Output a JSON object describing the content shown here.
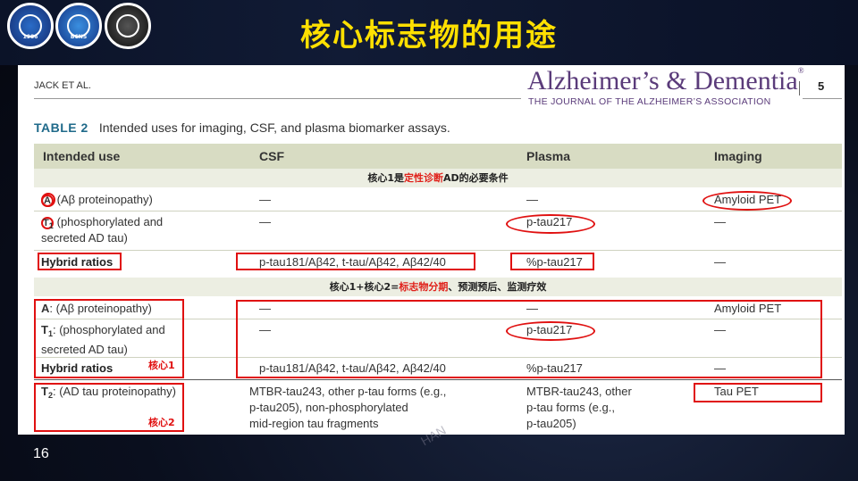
{
  "slide": {
    "title": "核心标志物的用途",
    "number": "16",
    "watermark": "HAN",
    "logos": [
      {
        "name": "association-logo-1",
        "year": "1986"
      },
      {
        "name": "bcns-logo",
        "text": "BCNS"
      },
      {
        "name": "brain-seal-logo"
      }
    ]
  },
  "document": {
    "running_head": "JACK ET AL.",
    "journal": "Alzheimer’s & Dementia",
    "journal_subtitle": "THE JOURNAL OF THE ALZHEIMER’S ASSOCIATION",
    "page_number": "5",
    "caption_label": "TABLE 2",
    "caption_text": "Intended uses for imaging, CSF, and plasma biomarker assays."
  },
  "table": {
    "headers": [
      "Intended use",
      "CSF",
      "Plasma",
      "Imaging"
    ],
    "band1": {
      "pre": "核心1是",
      "highlight": "定性诊断",
      "post": "AD的必要条件"
    },
    "band2": {
      "pre": "核心1+核心2=",
      "highlight": "标志物分期",
      "post": "、预测预后、监测疗效"
    },
    "rows": {
      "r1": {
        "use": "(Aβ proteinopathy)",
        "csf": "—",
        "plasma": "—",
        "imaging": "Amyloid PET"
      },
      "r2": {
        "use_a": "(phosphorylated and",
        "use_b": "secreted AD tau)",
        "csf": "—",
        "plasma": "p-tau217",
        "imaging": "—"
      },
      "r3": {
        "use": "Hybrid ratios",
        "csf": "p-tau181/Aβ42, t-tau/Aβ42, Aβ42/40",
        "plasma": "%p-tau217",
        "imaging": "—"
      },
      "r4": {
        "use": ": (Aβ proteinopathy)",
        "csf": "—",
        "plasma": "—",
        "imaging": "Amyloid PET"
      },
      "r5": {
        "use_a": ": (phosphorylated and",
        "use_b": "secreted AD tau)",
        "csf": "—",
        "plasma": "p-tau217",
        "imaging": "—"
      },
      "r6": {
        "use": "Hybrid ratios",
        "csf": "p-tau181/Aβ42, t-tau/Aβ42, Aβ42/40",
        "plasma": "%p-tau217",
        "imaging": "—"
      },
      "r7": {
        "use": ": (AD tau proteinopathy)",
        "csf_a": "MTBR-tau243, other p-tau forms (e.g.,",
        "csf_b": "p-tau205), non-phosphorylated",
        "csf_c": "mid-region tau fragments",
        "plasma_a": "MTBR-tau243, other",
        "plasma_b": "p-tau forms (e.g.,",
        "plasma_c": "p-tau205)",
        "imaging": "Tau PET"
      }
    },
    "labels": {
      "a": "A",
      "t": "T",
      "sub1": "1",
      "sub2": "2"
    },
    "notes": {
      "core1": "核心1",
      "core2": "核心2"
    }
  }
}
